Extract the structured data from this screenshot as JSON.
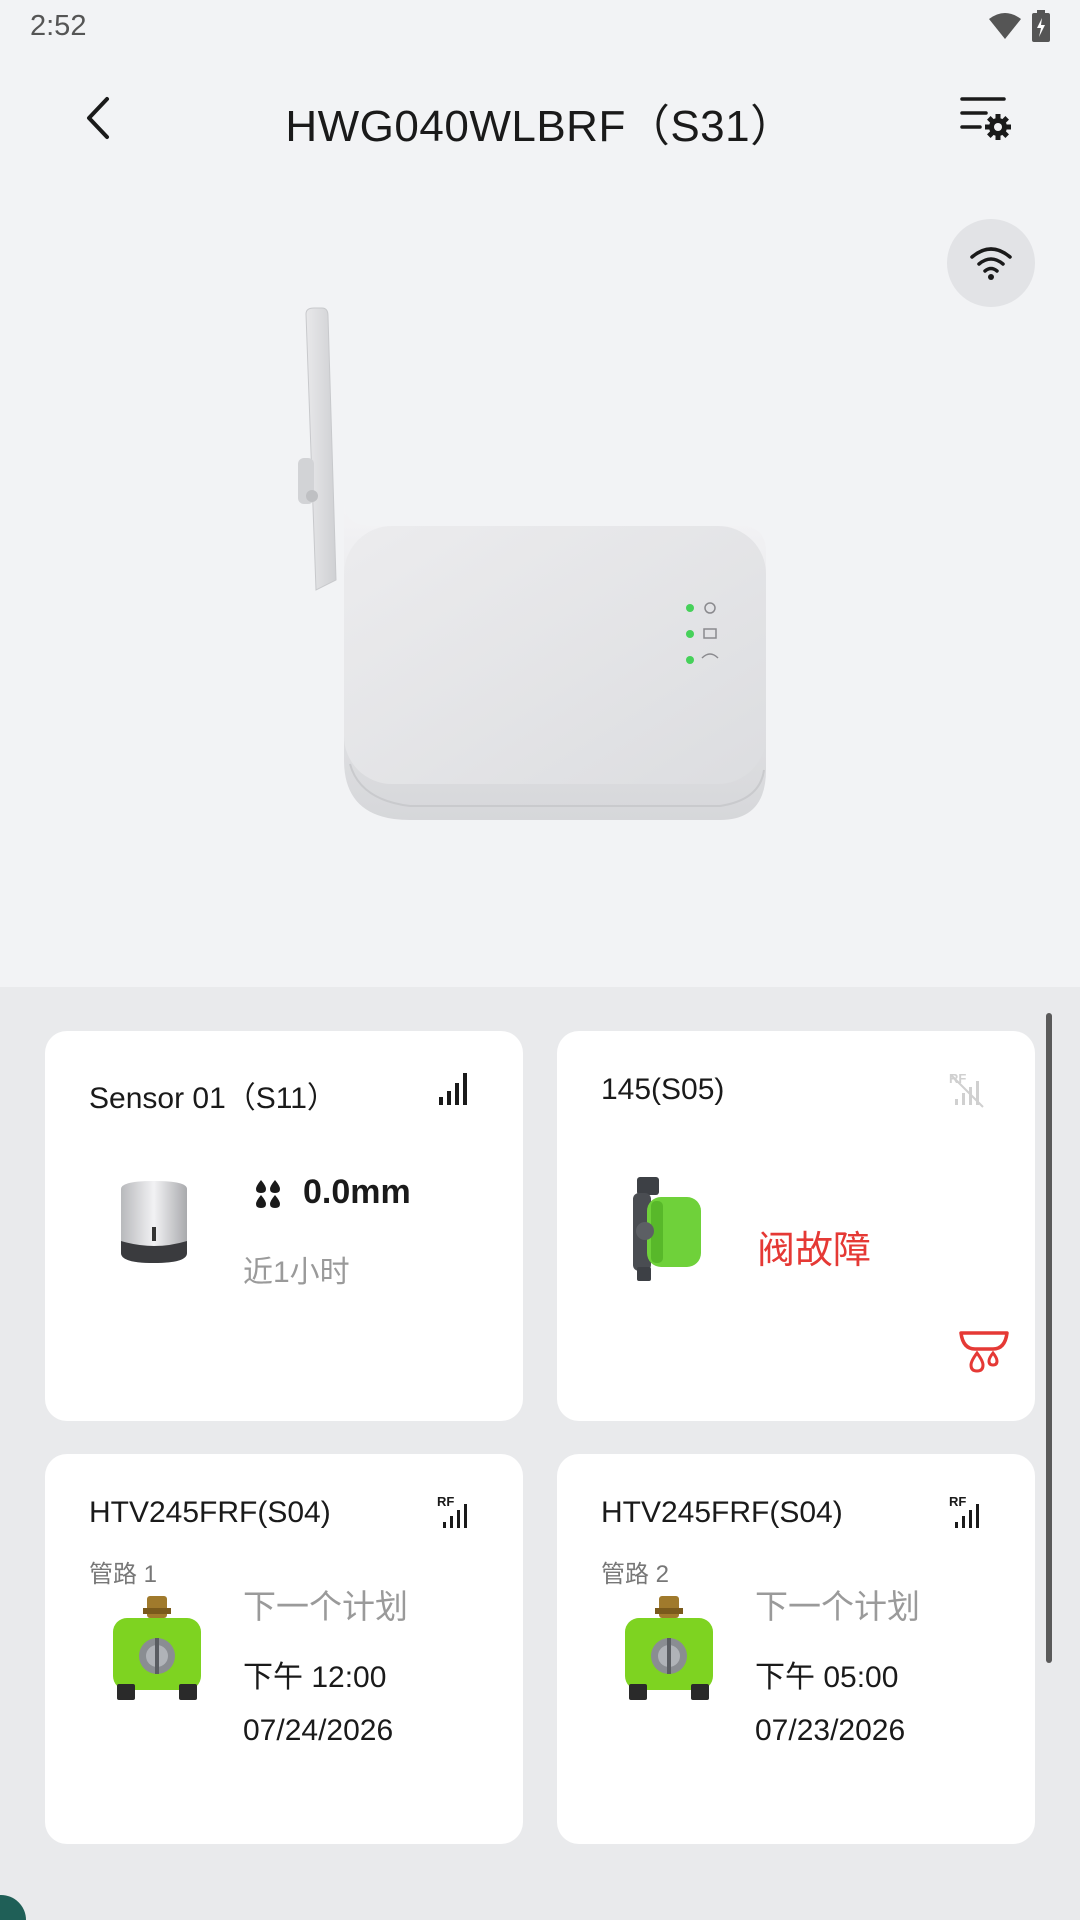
{
  "status_bar": {
    "time": "2:52",
    "wifi_icon": "wifi-icon",
    "battery_icon": "battery-charging-icon"
  },
  "header": {
    "title": "HWG040WLBRF（S31）",
    "back_icon": "chevron-left-icon",
    "settings_icon": "list-settings-icon"
  },
  "gateway": {
    "connection_icon": "wifi-icon",
    "image": "gateway-device-image"
  },
  "colors": {
    "fault": "#e53935",
    "timer_green": "#7ed321",
    "valve_green": "#6fd13a",
    "background": "#f2f3f5"
  },
  "cards": [
    {
      "title": "Sensor 01（S11）",
      "signal_icon": "signal-bars-icon",
      "reading_icon": "raindrops-icon",
      "value": "0.0mm",
      "period": "近1小时"
    },
    {
      "title": "145(S05)",
      "signal_icon": "rf-no-signal-icon",
      "status": "阀故障",
      "alert_icon": "valve-leak-icon"
    },
    {
      "title": "HTV245FRF(S04)",
      "signal_icon": "rf-signal-icon",
      "pipe": "管路 1",
      "next_label": "下一个计划",
      "time": "下午 12:00",
      "date": "07/24/2026"
    },
    {
      "title": "HTV245FRF(S04)",
      "signal_icon": "rf-signal-icon",
      "pipe": "管路 2",
      "next_label": "下一个计划",
      "time": "下午 05:00",
      "date": "07/23/2026"
    }
  ]
}
